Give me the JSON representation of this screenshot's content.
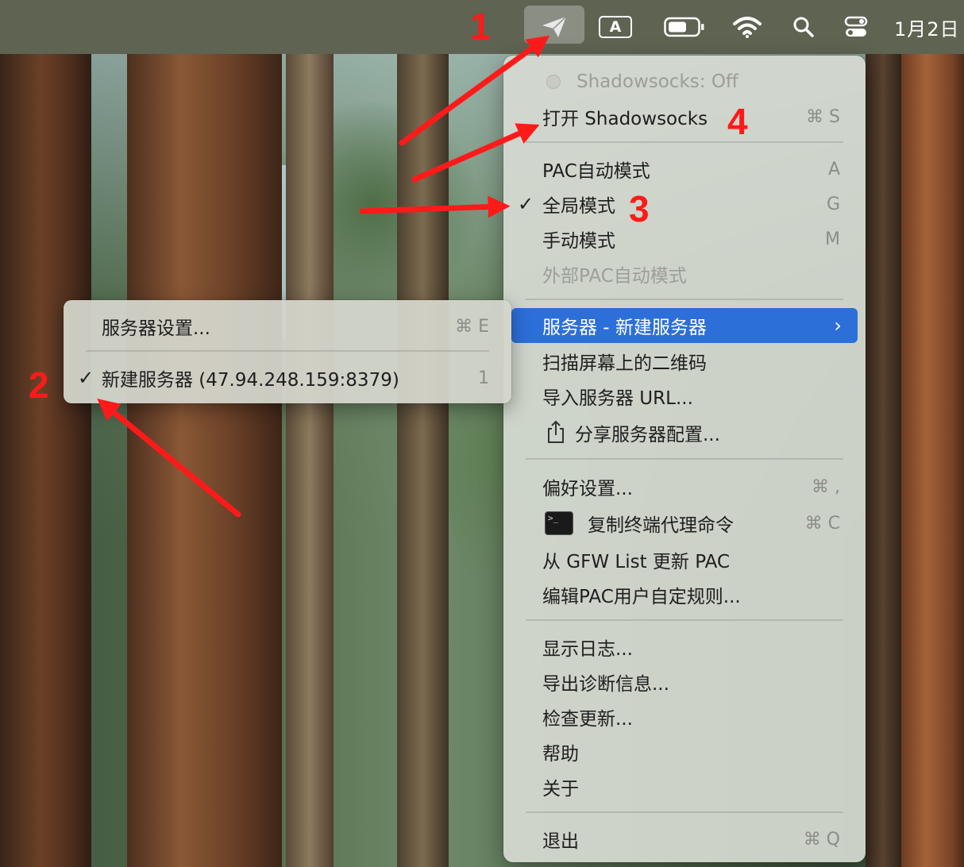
{
  "menubar": {
    "input_source": "A",
    "clock": "1月2日"
  },
  "main_menu": {
    "status": "Shadowsocks: Off",
    "toggle": {
      "label": "打开 Shadowsocks",
      "shortcut": "⌘ S"
    },
    "modes": [
      {
        "label": "PAC自动模式",
        "shortcut": "A",
        "checked": false
      },
      {
        "label": "全局模式",
        "shortcut": "G",
        "checked": true
      },
      {
        "label": "手动模式",
        "shortcut": "M",
        "checked": false
      },
      {
        "label": "外部PAC自动模式",
        "shortcut": "",
        "disabled": true
      }
    ],
    "server": {
      "label": "服务器 - 新建服务器",
      "arrow": "›"
    },
    "scan_qr": "扫描屏幕上的二维码",
    "import_url": "导入服务器 URL...",
    "share_config": "分享服务器配置...",
    "preferences": {
      "label": "偏好设置...",
      "shortcut": "⌘ ,"
    },
    "copy_proxy_cmd": {
      "label": "复制终端代理命令",
      "shortcut": "⌘ C"
    },
    "update_pac": "从 GFW List 更新 PAC",
    "edit_pac_rules": "编辑PAC用户自定规则...",
    "show_log": "显示日志...",
    "export_diag": "导出诊断信息...",
    "check_updates": "检查更新...",
    "help": "帮助",
    "about": "关于",
    "quit": {
      "label": "退出",
      "shortcut": "⌘ Q"
    }
  },
  "submenu": {
    "server_settings": {
      "label": "服务器设置...",
      "shortcut": "⌘ E"
    },
    "server_entry": {
      "label": "新建服务器 (47.94.248.159:8379)",
      "shortcut": "1",
      "checked": true
    }
  },
  "annotations": {
    "n1": "1",
    "n2": "2",
    "n3": "3",
    "n4": "4",
    "color": "#ff1a1a"
  },
  "colors": {
    "selection": "#2c6fd8",
    "menubar": "#5f6352"
  }
}
